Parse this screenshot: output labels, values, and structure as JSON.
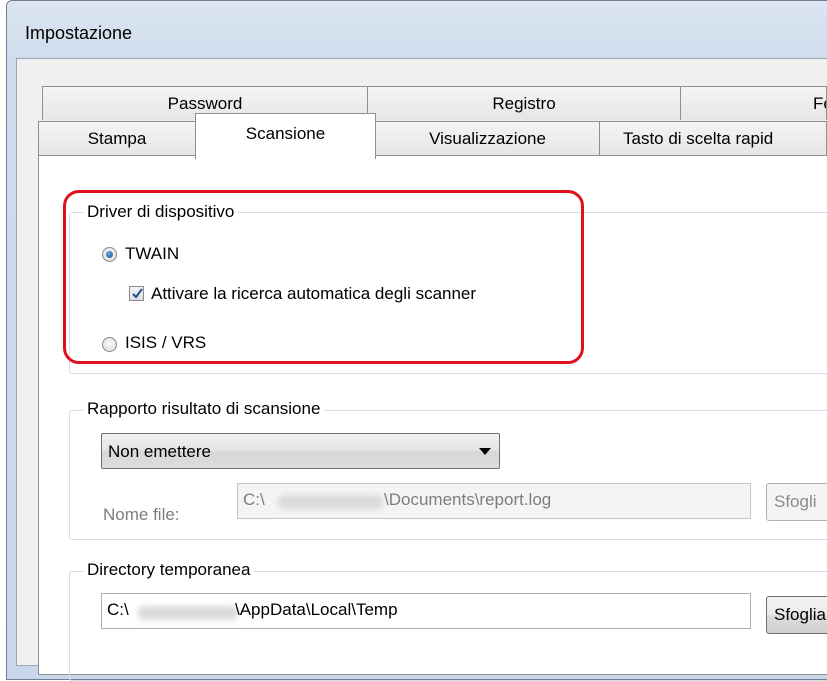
{
  "window": {
    "title": "Impostazione"
  },
  "tabs_top": [
    {
      "label": "Password"
    },
    {
      "label": "Registro"
    },
    {
      "label": "For"
    }
  ],
  "tabs_bottom": [
    {
      "label": "Stampa"
    },
    {
      "label": "Scansione"
    },
    {
      "label": "Visualizzazione"
    },
    {
      "label": "Tasto di scelta rapid"
    }
  ],
  "driver_group": {
    "title": "Driver di dispositivo",
    "twain_label": "TWAIN",
    "twain_selected": true,
    "auto_search_label": "Attivare la ricerca automatica degli scanner",
    "auto_search_checked": true,
    "isis_label": "ISIS / VRS",
    "isis_selected": false
  },
  "report_group": {
    "title": "Rapporto risultato di scansione",
    "output_selected": "Non emettere",
    "filename_label": "Nome file:",
    "filename_prefix": "C:\\",
    "filename_suffix": "\\Documents\\report.log",
    "browse_label": "Sfogli"
  },
  "temp_group": {
    "title": "Directory temporanea",
    "path_prefix": "C:\\",
    "path_suffix": "\\AppData\\Local\\Temp",
    "browse_label": "Sfoglia"
  },
  "colors": {
    "highlight": "#e0101a",
    "radio_dot": "#1b4f95"
  }
}
